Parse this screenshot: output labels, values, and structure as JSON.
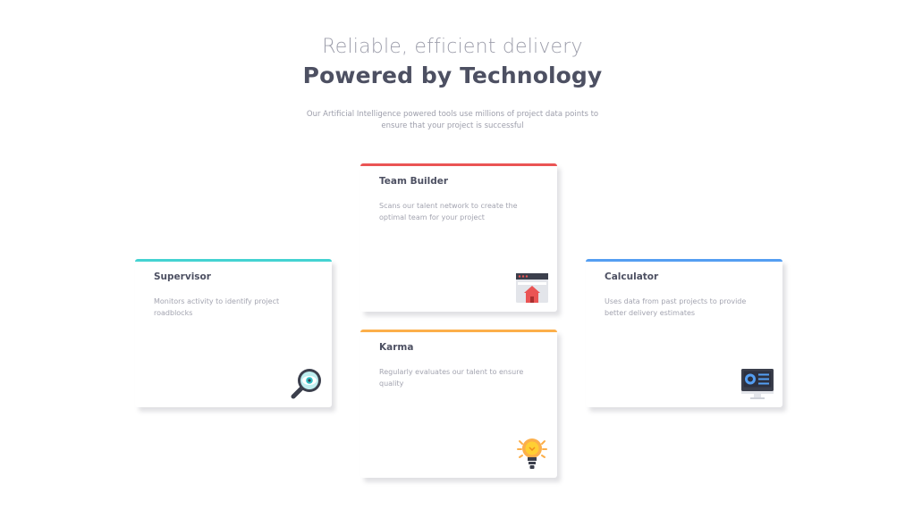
{
  "header": {
    "subtitle": "Reliable, efficient delivery",
    "title": "Powered by Technology",
    "intro_line1": "Our Artificial Intelligence powered tools use millions of project data points to",
    "intro_line2": "ensure that your project is successful"
  },
  "cards": {
    "supervisor": {
      "title": "Supervisor",
      "desc": "Monitors activity to identify project roadblocks",
      "accent": "#44d3d2",
      "icon": "magnifier-eye-icon"
    },
    "team_builder": {
      "title": "Team Builder",
      "desc": "Scans our talent network to create the optimal team for your project",
      "accent": "#ea5454",
      "icon": "browser-house-icon"
    },
    "karma": {
      "title": "Karma",
      "desc": "Regularly evaluates our talent to ensure quality",
      "accent": "#fcaf4a",
      "icon": "lightbulb-icon"
    },
    "calculator": {
      "title": "Calculator",
      "desc": "Uses data from past projects to provide better delivery estimates",
      "accent": "#549ef2",
      "icon": "monitor-chart-icon"
    }
  }
}
